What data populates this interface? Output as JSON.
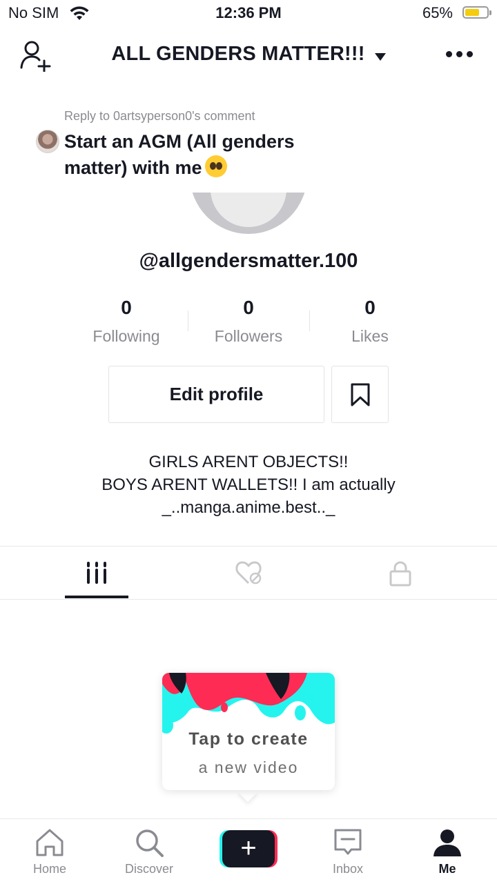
{
  "status_bar": {
    "carrier": "No SIM",
    "time": "12:36 PM",
    "battery_percent": "65%"
  },
  "header": {
    "title": "ALL GENDERS MATTER!!!"
  },
  "reply": {
    "reply_to": "Reply to 0artsyperson0's comment",
    "text": "Start an AGM (All genders matter) with me"
  },
  "profile": {
    "username": "@allgendersmatter.100",
    "stats": [
      {
        "value": "0",
        "label": "Following"
      },
      {
        "value": "0",
        "label": "Followers"
      },
      {
        "value": "0",
        "label": "Likes"
      }
    ],
    "edit_button": "Edit profile",
    "bio_lines": [
      "GIRLS ARENT OBJECTS!!",
      "BOYS ARENT WALLETS!! I am actually",
      "_..manga.anime.best.._"
    ]
  },
  "content_tabs": [
    {
      "icon": "grid-icon",
      "active": true
    },
    {
      "icon": "liked-hidden-icon",
      "active": false
    },
    {
      "icon": "lock-icon",
      "active": false
    }
  ],
  "create_card": {
    "line1": "Tap to create",
    "line2": "a new video"
  },
  "bottom_nav": [
    {
      "label": "Home",
      "icon": "home-icon"
    },
    {
      "label": "Discover",
      "icon": "search-icon"
    },
    {
      "label": "",
      "icon": "plus-icon"
    },
    {
      "label": "Inbox",
      "icon": "inbox-icon"
    },
    {
      "label": "Me",
      "icon": "person-icon",
      "active": true
    }
  ],
  "colors": {
    "text": "#161823",
    "muted": "#8a8b91",
    "brand_cyan": "#25f4ee",
    "brand_red": "#fe2c55",
    "battery": "#f5cc0e"
  }
}
